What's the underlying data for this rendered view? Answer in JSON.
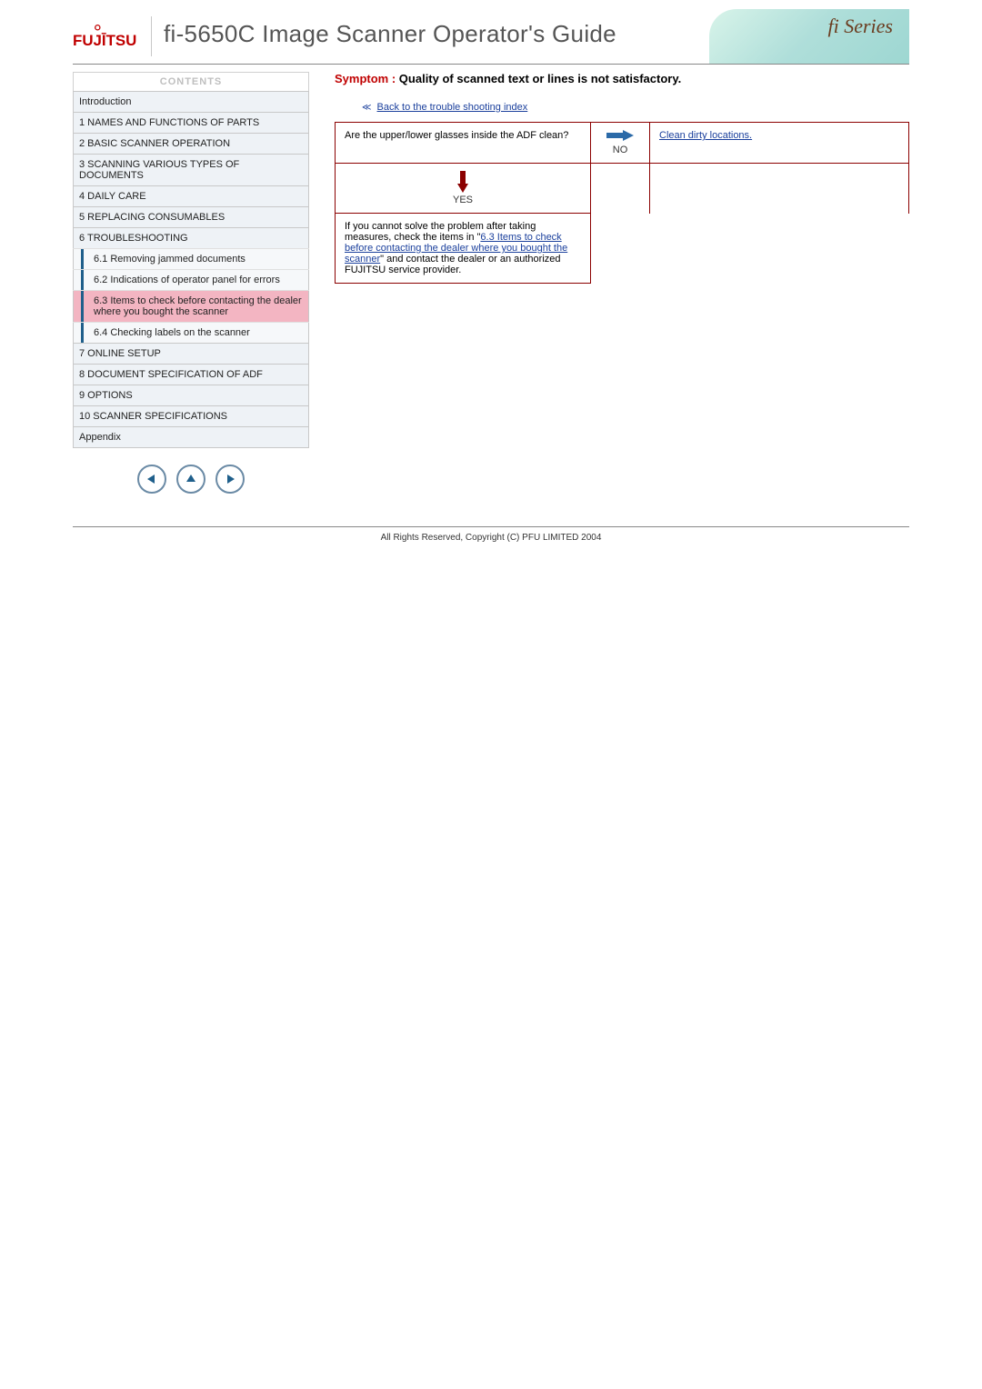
{
  "header": {
    "logo_text": "FUJITSU",
    "title": "fi-5650C Image Scanner Operator's Guide",
    "fi_series": "fi Series"
  },
  "sidebar": {
    "heading": "CONTENTS",
    "items": [
      {
        "label": "Introduction",
        "sub": false,
        "active": false
      },
      {
        "label": "1 NAMES AND FUNCTIONS OF PARTS",
        "sub": false,
        "active": false
      },
      {
        "label": "2 BASIC SCANNER OPERATION",
        "sub": false,
        "active": false
      },
      {
        "label": "3 SCANNING VARIOUS TYPES OF DOCUMENTS",
        "sub": false,
        "active": false
      },
      {
        "label": "4 DAILY CARE",
        "sub": false,
        "active": false
      },
      {
        "label": "5 REPLACING CONSUMABLES",
        "sub": false,
        "active": false
      },
      {
        "label": "6 TROUBLESHOOTING",
        "sub": false,
        "active": false
      },
      {
        "label": "6.1 Removing jammed documents",
        "sub": true,
        "active": false
      },
      {
        "label": "6.2 Indications of operator panel for errors",
        "sub": true,
        "active": false
      },
      {
        "label": "6.3 Items to check before contacting the dealer where you bought the scanner",
        "sub": true,
        "active": true
      },
      {
        "label": "6.4 Checking labels on the scanner",
        "sub": true,
        "active": false
      },
      {
        "label": "7 ONLINE SETUP",
        "sub": false,
        "active": false
      },
      {
        "label": "8 DOCUMENT SPECIFICATION OF ADF",
        "sub": false,
        "active": false
      },
      {
        "label": "9 OPTIONS",
        "sub": false,
        "active": false
      },
      {
        "label": "10 SCANNER SPECIFICATIONS",
        "sub": false,
        "active": false
      },
      {
        "label": "Appendix",
        "sub": false,
        "active": false
      }
    ]
  },
  "content": {
    "symptom_prefix": "Symptom : ",
    "symptom_text": "Quality of scanned text or lines is not satisfactory.",
    "back_link": "Back to the trouble shooting index",
    "flow": {
      "q1": "Are the upper/lower glasses inside the ADF clean?",
      "no_label": "NO",
      "a1": "Clean dirty locations.",
      "yes_label": "YES",
      "final_pre": "If you cannot solve the problem after taking measures, check the items in \"",
      "final_link": "6.3 Items to check before contacting the dealer where you bought the scanner",
      "final_post": "\" and contact the dealer or an authorized FUJITSU service provider."
    }
  },
  "footer": "All Rights Reserved, Copyright (C) PFU LIMITED 2004"
}
